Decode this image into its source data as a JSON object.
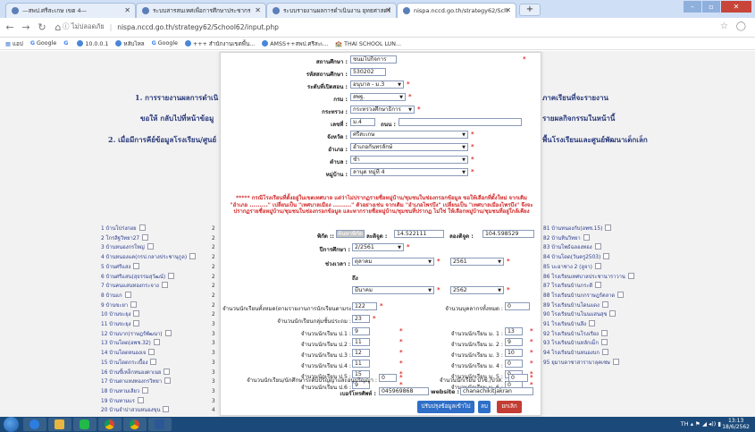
{
  "browser": {
    "tabs": [
      {
        "title": "—สพป.ศรีสะเกษ เขต 4—"
      },
      {
        "title": "ระบบสารสนเทศเพื่อการศึกษาประชากร"
      },
      {
        "title": "ระบบรายงานผลการดำเนินงาน ยุทธศาสตร์"
      },
      {
        "title": "nispa.nccd.go.th/strategy62/Sch"
      }
    ],
    "url_warning": "ไม่ปลอดภัย",
    "url": "nispa.nccd.go.th/strategy62/School62/input.php",
    "bookmarks": {
      "apps": "แอป",
      "items": [
        "Google",
        "10.0.0.1",
        "หลับไหล",
        "Google",
        "+++ สำนักงานเขตพื้น...",
        "AMSS++สพป.ศรีสะเ...",
        "THAI SCHOOL LUN..."
      ]
    }
  },
  "background": {
    "left_headings": [
      "1. การรายงานผลการดำเนิ",
      "ขอให้ กลับไปที่หน้าข้อมู",
      "2. เมื่อมีการคีย์ข้อมูลโรงเรียน/ศูนย์"
    ],
    "right_headings": [
      "ภาคเรียนที่จะรายงาน",
      "รายผลกิจกรรมในหน้านี้",
      "พื้นโรงเรียนและศูนย์พัฒนาเด็กเล็ก"
    ],
    "left_list": [
      "1 บ้านโปร่งกอย",
      "2 โกรสิฐวิทยา27",
      "3 บ้านหนองกรใหญ่",
      "4 บ้านหนองแค(กรป.กลางประชานุกูล)",
      "5 บ้านศรีแสง",
      "6 บ้านศรีแสน(สุธรรมสุวัฒน์)",
      "7 บ้านคนแสนทองกระจาง",
      "8 บ้านแก",
      "9 บ้านขะยา",
      "10 บ้านขะยุง",
      "11 บ้านขะยุง",
      "12 บ้านบาก(ราษฎร์พัฒนา)",
      "13 บ้านโดด(อพช.32)",
      "14 บ้านโดดหนองเจ",
      "15 บ้านโดดกระเบื้อง",
      "16 บ้านขี้เหล็กหนองตาเนย",
      "17 บ้านตาแทงทองกรวิทยา",
      "18 บ้านทามเลียว",
      "19 บ้านทามแร",
      "20 บ้านจำปาสวนหนองขุน"
    ],
    "right_list": [
      "81 บ้านหนองกับ(อพช.15)",
      "82 บ้านหินวิทยา",
      "83 บ้านโพธ์ฉลองทอง",
      "84 บ้านโดด(วันครู2503)",
      "85 บะอาซาง 2 (ลูจา)",
      "86 โรงเรียนเทศบาลประชานาราวาน",
      "87 โรงเรียนบ้านกระดี",
      "88 โรงเรียนบ้านกกราษฎร์ตลาด",
      "89 โรงเรียนบ้านโดนแดง",
      "90 โรงเรียนบ้านโนนแสนสุข",
      "91 โรงเรียนบ้านลึง",
      "92 โรงเรียนบ้านโรงเรียง",
      "93 โรงเรียนบ้านหลักเม็ก",
      "94 โรงเรียนบ้านหนองบก",
      "95 ยุมาบดาซาสาราบาลุคเซษ"
    ],
    "left_digits": [
      "2",
      "2",
      "2",
      "2",
      "2",
      "2",
      "2",
      "2",
      "2",
      "2",
      "3",
      "3",
      "3",
      "3",
      "3",
      "3",
      "3",
      "3",
      "3",
      "4"
    ]
  },
  "form": {
    "school_name": {
      "label": "สถานศึกษา :",
      "value": "ชนมไปกิจการ"
    },
    "school_code": {
      "label": "รหัสสถานศึกษา :",
      "value": "530202"
    },
    "level": {
      "label": "ระดับที่เปิดสอน :",
      "value": "อนุบาล - ม.3"
    },
    "ministry": {
      "label": "กรม :",
      "value": "สพฐ."
    },
    "ministry_dept": {
      "label": "กระทรวง :",
      "value": "กระทรวงศึกษาธิการ"
    },
    "address_no": {
      "label": "เลขที่ :",
      "value": "ม.4"
    },
    "road": {
      "label": "ถนน :",
      "value": ""
    },
    "province": {
      "label": "จังหวัด :",
      "value": "ศรีสะเกษ"
    },
    "district": {
      "label": "อำเภอ :",
      "value": "อำเภอกันทรลักษ์"
    },
    "subdistrict": {
      "label": "ตำบล :",
      "value": "ชำ"
    },
    "village": {
      "label": "หมู่บ้าน :",
      "value": "ลานุด หมู่ที่ 4"
    },
    "notice": "***** กรณีโรงเรียนที่ตั้งอยู่ในเขตเทศบาล แต่ว่าไม่ปรากฏรายชื่อหมู่บ้าน/ชุมชนในช่องกรอกข้อมูล ขอให้เลือกที่ตั้งใหม่ จากเดิม \"อำเภอ .........\" เปลี่ยนเป็น \"เทศบาลเมือง .........\" ตัวอย่างเช่น จากเดิม \"อำเภอไพรบึง\" เปลี่ยนเป็น \"เทศบาลเมืองไพรบึง\" จึงจะปรากฏรายชื่อหมู่บ้าน/ชุมชนในช่องกรอกข้อมูล และหากรายชื่อหมู่บ้าน/ชุมชนที่ปรากฏ ไม่ใช่ ให้เลือกหมู่บ้าน/ชุมชนที่อยู่ใกล้เคียง",
    "coords": {
      "prefix": "พิกัด ::",
      "find_btn": "ค้นหาพิกัด",
      "lat_label": "ละติจูด :",
      "lat": "14.522111",
      "lng_label": "ลองติจูด :",
      "lng": "104.598529"
    },
    "semester": {
      "label": "ปีการศึกษา :",
      "value": "2/2561"
    },
    "period_from": {
      "label": "ช่วงเวลา :",
      "month": "ตุลาคม",
      "year": "2561"
    },
    "period_to": {
      "label": "ถึง",
      "month": "มีนาคม",
      "year": "2562"
    },
    "students_total": {
      "label": "จำนวนนักเรียนทั้งหมด(ตามรายงานการนักเรียนตามระดับชั้น) :",
      "value": "122"
    },
    "staff_total": {
      "label": "จำนวนบุคลากรทั้งหมด :",
      "value": "0"
    },
    "students_primary": {
      "label": "จำนวนนักเรียนกลุ่มชั้นประถม :",
      "value": "23"
    },
    "p_grades": [
      {
        "label": "จำนวนนักเรียน ป.1 :",
        "value": "9"
      },
      {
        "label": "จำนวนนักเรียน ป.2 :",
        "value": "11"
      },
      {
        "label": "จำนวนนักเรียน ป.3 :",
        "value": "12"
      },
      {
        "label": "จำนวนนักเรียน ป.4 :",
        "value": "11"
      },
      {
        "label": "จำนวนนักเรียน ป.5 :",
        "value": "15"
      },
      {
        "label": "จำนวนนักเรียน ป.6 :",
        "value": "9"
      }
    ],
    "m_grades": [
      {
        "label": "จำนวนนักเรียน ม. 1 :",
        "value": "13"
      },
      {
        "label": "จำนวนนักเรียน ม. 2 :",
        "value": "9"
      },
      {
        "label": "จำนวนนักเรียน ม. 3 :",
        "value": "10"
      },
      {
        "label": "จำนวนนักเรียน ม. 4 :",
        "value": "0"
      },
      {
        "label": "จำนวนนักเรียน ม. 5 :",
        "value": "0"
      },
      {
        "label": "จำนวนนักเรียน ม. 6 :",
        "value": "0"
      }
    ],
    "bachelor": {
      "label": "จำนวนนักเรียน/นักศึกษาระดับปริญญาและอนุปริญญา :",
      "value": "0"
    },
    "vocational": {
      "label": "จำนวนนักเรียน ปวช./ปวส. :",
      "value": "0"
    },
    "phone": {
      "label": "เบอร์โทรศัพท์ :",
      "value": "045969868"
    },
    "website": {
      "label": "website :",
      "value": "chanachikitjakran"
    },
    "buttons": {
      "update": "ปรับปรุงข้อมูลเข้าไป",
      "delete": "ลบ",
      "cancel": "ยกเลิก"
    }
  },
  "taskbar": {
    "tray": "TH",
    "time": "13:13",
    "date": "18/6/2562"
  }
}
